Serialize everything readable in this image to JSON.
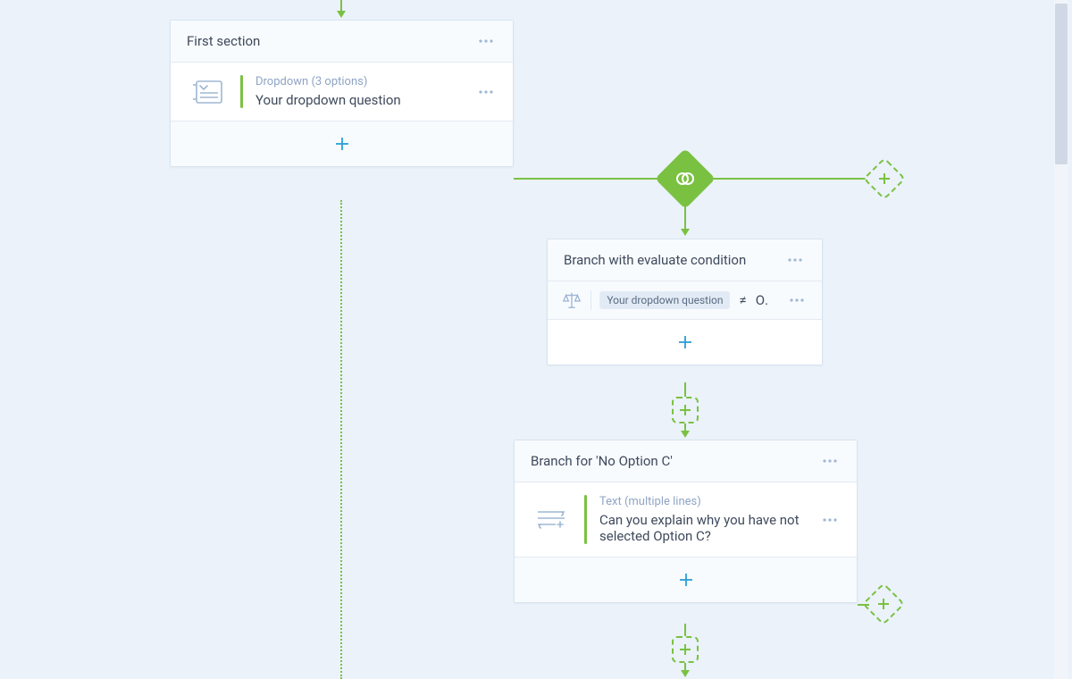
{
  "colors": {
    "accent_green": "#7ac142",
    "accent_blue": "#2a9fd6",
    "bg": "#ebf2fa"
  },
  "section1": {
    "title": "First section",
    "question": {
      "type_label": "Dropdown (3 options)",
      "prompt": "Your dropdown question"
    }
  },
  "branch_eval": {
    "title": "Branch with evaluate condition",
    "condition": {
      "field_label": "Your dropdown question",
      "operator": "≠",
      "value_label": "Optio…"
    }
  },
  "branch_no_c": {
    "title": "Branch for 'No Option C'",
    "question": {
      "type_label": "Text (multiple lines)",
      "prompt": "Can you explain why you have not selected Option C?"
    }
  }
}
